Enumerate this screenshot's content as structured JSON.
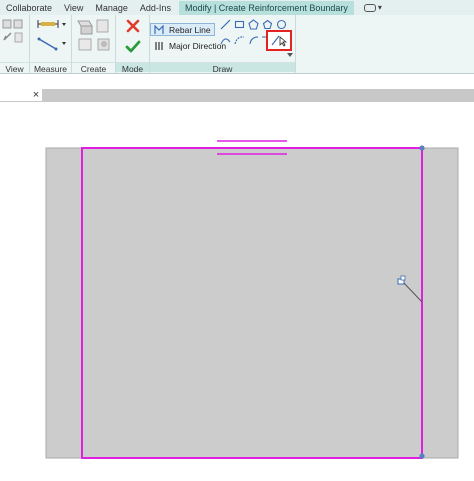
{
  "tabs": [
    "Collaborate",
    "View",
    "Manage",
    "Add-Ins"
  ],
  "context_tab": "Modify | Create Reinforcement Boundary",
  "panels": {
    "view": "View",
    "measure": "Measure",
    "create": "Create",
    "mode": "Mode",
    "draw": "Draw"
  },
  "draw_buttons": {
    "rebar_line": "Rebar Line",
    "major_direction": "Major Direction"
  },
  "view_tab": {
    "close_glyph": "×"
  },
  "colors": {
    "boundary": "#e020e0",
    "slab_fill": "#cccccc",
    "finish_x": "#e03a2a",
    "finish_check": "#2a9a3a",
    "highlight": "#e32222"
  },
  "icons": [
    "finish-edit-mode-icon",
    "cancel-edit-mode-icon",
    "pick-walls-icon"
  ]
}
